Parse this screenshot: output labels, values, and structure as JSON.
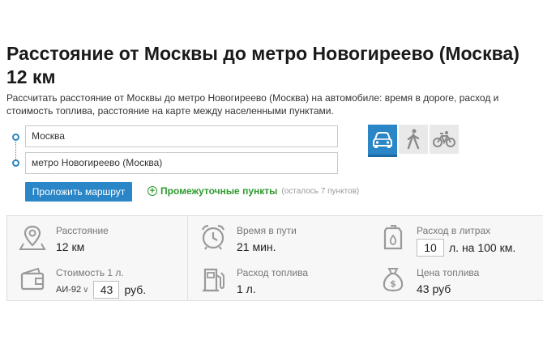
{
  "page": {
    "title": "Расстояние от Москвы до метро Новогиреево (Москва) 12 км",
    "description": "Рассчитать расстояние от Москвы до метро Новогиреево (Москва) на автомобиле: время в дороге, расход и стоимость топлива, расстояние на карте между населенными пунктами."
  },
  "route": {
    "from": "Москва",
    "to": "метро Новогиреево (Москва)",
    "modes": [
      "car-icon",
      "walk-icon",
      "bike-icon"
    ],
    "active_mode": "car",
    "build_button": "Проложить маршрут",
    "waypoints_label": "Промежуточные пункты",
    "waypoints_note": "(осталось 7 пунктов)"
  },
  "stats": {
    "distance": {
      "label": "Расстояние",
      "value": "12 км"
    },
    "time": {
      "label": "Время в пути",
      "value": "21 мин."
    },
    "consumption": {
      "label": "Расход в литрах",
      "value": "10",
      "unit": "л. на 100 км."
    },
    "cost_per_liter": {
      "label": "Стоимость 1 л.",
      "fuel_type": "АИ-92",
      "value": "43",
      "unit": "руб."
    },
    "fuel_used": {
      "label": "Расход топлива",
      "value": "1 л."
    },
    "fuel_price": {
      "label": "Цена топлива",
      "value": "43 руб"
    }
  },
  "colors": {
    "accent": "#2a86c6",
    "green": "#2e9a2e",
    "icon_gray": "#9a9a9a"
  }
}
